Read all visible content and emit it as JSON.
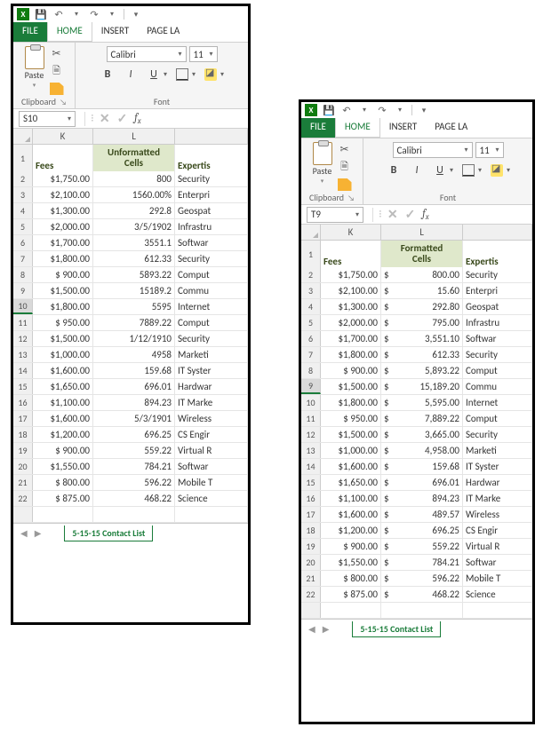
{
  "titlebar": {
    "icons": {
      "excel": "X",
      "save": "💾",
      "undo": "↶",
      "redo": "↷",
      "dd": "▾"
    }
  },
  "tabs": {
    "file": "FILE",
    "home": "HOME",
    "insert": "INSERT",
    "pagelayout": "PAGE LA"
  },
  "ribbon": {
    "paste_label": "Paste",
    "clipboard_label": "Clipboard",
    "font_label": "Font",
    "font_name": "Calibri",
    "font_size": "11",
    "launcher": "↘",
    "b": "B",
    "i": "I",
    "u": "U",
    "dd": "▾"
  },
  "fx": {
    "left": {
      "name": "S10"
    },
    "right": {
      "name": "T9"
    },
    "dd": "▾",
    "dots": "⁝",
    "cancel": "✕",
    "enter": "✓"
  },
  "columns": {
    "k": "K",
    "l": "L",
    "m": ""
  },
  "sheet_tab": "5-15-15 Contact List",
  "left_window": {
    "header": {
      "fees": "Fees",
      "l_line1": "Unformatted",
      "l_line2": "Cells",
      "expertise": "Expertis"
    },
    "selected_row": 10,
    "rows": [
      {
        "n": 2,
        "k": "$1,750.00",
        "l": "800",
        "m": "Security"
      },
      {
        "n": 3,
        "k": "$2,100.00",
        "l": "1560.00%",
        "m": "Enterpri"
      },
      {
        "n": 4,
        "k": "$1,300.00",
        "l": "292.8",
        "m": "Geospat"
      },
      {
        "n": 5,
        "k": "$2,000.00",
        "l": "3/5/1902",
        "m": "Infrastru"
      },
      {
        "n": 6,
        "k": "$1,700.00",
        "l": "3551.1",
        "m": "Softwar"
      },
      {
        "n": 7,
        "k": "$1,800.00",
        "l": "612.33",
        "m": "Security"
      },
      {
        "n": 8,
        "k": "$   900.00",
        "l": "5893.22",
        "m": "Comput"
      },
      {
        "n": 9,
        "k": "$1,500.00",
        "l": "15189.2",
        "m": "Commu"
      },
      {
        "n": 10,
        "k": "$1,800.00",
        "l": "5595",
        "m": "Internet"
      },
      {
        "n": 11,
        "k": "$   950.00",
        "l": "7889.22",
        "m": "Comput"
      },
      {
        "n": 12,
        "k": "$1,500.00",
        "l": "1/12/1910",
        "m": "Security"
      },
      {
        "n": 13,
        "k": "$1,000.00",
        "l": "4958",
        "m": "Marketi"
      },
      {
        "n": 14,
        "k": "$1,600.00",
        "l": "159.68",
        "m": "IT Syster"
      },
      {
        "n": 15,
        "k": "$1,650.00",
        "l": "696.01",
        "m": "Hardwar"
      },
      {
        "n": 16,
        "k": "$1,100.00",
        "l": "894.23",
        "m": "IT Marke"
      },
      {
        "n": 17,
        "k": "$1,600.00",
        "l": "5/3/1901",
        "m": "Wireless"
      },
      {
        "n": 18,
        "k": "$1,200.00",
        "l": "696.25",
        "m": "CS Engir"
      },
      {
        "n": 19,
        "k": "$   900.00",
        "l": "559.22",
        "m": "Virtual R"
      },
      {
        "n": 20,
        "k": "$1,550.00",
        "l": "784.21",
        "m": "Softwar"
      },
      {
        "n": 21,
        "k": "$   800.00",
        "l": "596.22",
        "m": "Mobile T"
      },
      {
        "n": 22,
        "k": "$   875.00",
        "l": "468.22",
        "m": "Science"
      }
    ]
  },
  "right_window": {
    "header": {
      "fees": "Fees",
      "l_line1": "Formatted",
      "l_line2": "Cells",
      "expertise": "Expertis"
    },
    "selected_row": 9,
    "rows": [
      {
        "n": 2,
        "k": "$1,750.00",
        "ld": "$",
        "lv": "800.00",
        "m": "Security"
      },
      {
        "n": 3,
        "k": "$2,100.00",
        "ld": "$",
        "lv": "15.60",
        "m": "Enterpri"
      },
      {
        "n": 4,
        "k": "$1,300.00",
        "ld": "$",
        "lv": "292.80",
        "m": "Geospat"
      },
      {
        "n": 5,
        "k": "$2,000.00",
        "ld": "$",
        "lv": "795.00",
        "m": "Infrastru"
      },
      {
        "n": 6,
        "k": "$1,700.00",
        "ld": "$",
        "lv": "3,551.10",
        "m": "Softwar"
      },
      {
        "n": 7,
        "k": "$1,800.00",
        "ld": "$",
        "lv": "612.33",
        "m": "Security"
      },
      {
        "n": 8,
        "k": "$   900.00",
        "ld": "$",
        "lv": "5,893.22",
        "m": "Comput"
      },
      {
        "n": 9,
        "k": "$1,500.00",
        "ld": "$",
        "lv": "15,189.20",
        "m": "Commu"
      },
      {
        "n": 10,
        "k": "$1,800.00",
        "ld": "$",
        "lv": "5,595.00",
        "m": "Internet"
      },
      {
        "n": 11,
        "k": "$   950.00",
        "ld": "$",
        "lv": "7,889.22",
        "m": "Comput"
      },
      {
        "n": 12,
        "k": "$1,500.00",
        "ld": "$",
        "lv": "3,665.00",
        "m": "Security"
      },
      {
        "n": 13,
        "k": "$1,000.00",
        "ld": "$",
        "lv": "4,958.00",
        "m": "Marketi"
      },
      {
        "n": 14,
        "k": "$1,600.00",
        "ld": "$",
        "lv": "159.68",
        "m": "IT Syster"
      },
      {
        "n": 15,
        "k": "$1,650.00",
        "ld": "$",
        "lv": "696.01",
        "m": "Hardwar"
      },
      {
        "n": 16,
        "k": "$1,100.00",
        "ld": "$",
        "lv": "894.23",
        "m": "IT Marke"
      },
      {
        "n": 17,
        "k": "$1,600.00",
        "ld": "$",
        "lv": "489.57",
        "m": "Wireless"
      },
      {
        "n": 18,
        "k": "$1,200.00",
        "ld": "$",
        "lv": "696.25",
        "m": "CS Engir"
      },
      {
        "n": 19,
        "k": "$   900.00",
        "ld": "$",
        "lv": "559.22",
        "m": "Virtual R"
      },
      {
        "n": 20,
        "k": "$1,550.00",
        "ld": "$",
        "lv": "784.21",
        "m": "Softwar"
      },
      {
        "n": 21,
        "k": "$   800.00",
        "ld": "$",
        "lv": "596.22",
        "m": "Mobile T"
      },
      {
        "n": 22,
        "k": "$   875.00",
        "ld": "$",
        "lv": "468.22",
        "m": "Science"
      }
    ]
  }
}
